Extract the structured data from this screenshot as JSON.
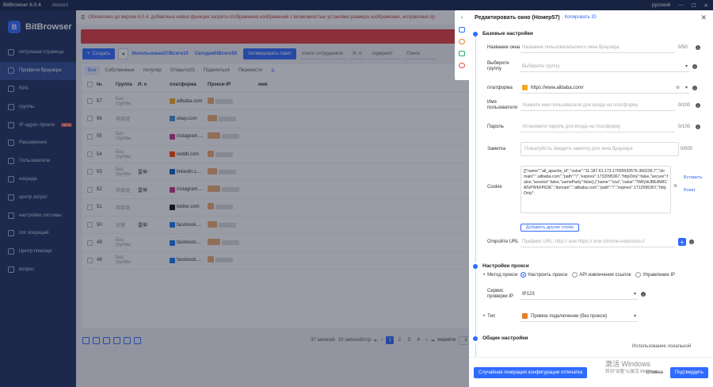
{
  "app": {
    "title": "BitBrowser 6.0.4",
    "user": "zenze1",
    "language": "русский",
    "logo_text": "BitBrowser"
  },
  "sidebar": {
    "items": [
      {
        "label": "питульная страница",
        "active": false
      },
      {
        "label": "Профили браузера",
        "active": true
      },
      {
        "label": "RPA",
        "active": false
      },
      {
        "label": "группы",
        "active": false
      },
      {
        "label": "IP-адрес прокси",
        "active": false,
        "badge": "NEW"
      },
      {
        "label": "Расширения",
        "active": false
      },
      {
        "label": "Пользователи",
        "active": false
      },
      {
        "label": "награда",
        "active": false
      },
      {
        "label": "центр затрат",
        "active": false
      },
      {
        "label": "настройки системы",
        "active": false
      },
      {
        "label": "лог операций",
        "active": false
      },
      {
        "label": "Центр помощи",
        "active": false
      },
      {
        "label": "вопрос",
        "active": false
      }
    ]
  },
  "notice": "Обновлено до версии 6.0.4, добавлена новая функция запрета отображения изображений с возможностью установки размера изображения, исправлена пр",
  "toolbar": {
    "create": "Создать",
    "used": "Использован37/Всего10",
    "today": "Сегодня0/Всего50",
    "activate": "Активировать пакет",
    "search_staff": "поиск сотрудников",
    "and_or": "И, о:",
    "contains": "содержит",
    "search": "Поиск"
  },
  "tabs": [
    "Все",
    "Собственные",
    "популяр",
    "Открыто(0)",
    "Поделиться",
    "Перенести"
  ],
  "table": {
    "headers": [
      "№",
      "Группа",
      "И. о",
      "платформа",
      "Прокси-IP",
      "имя"
    ],
    "rows": [
      {
        "no": "57",
        "group": "Без группы",
        "note": "",
        "platform": "alibaba.com",
        "icon_color": "#f5a623"
      },
      {
        "no": "56",
        "group": "项目组",
        "note": "",
        "platform": "ebay.com",
        "icon_color": "#4a90d9"
      },
      {
        "no": "55",
        "group": "Без группы",
        "note": "",
        "platform": "instagram....",
        "icon_color": "#c13584"
      },
      {
        "no": "54",
        "group": "Без группы",
        "note": "",
        "platform": "reddit.com",
        "icon_color": "#ff4500"
      },
      {
        "no": "53",
        "group": "Без группы",
        "note": "雷伸",
        "platform": "linkedin.c...",
        "icon_color": "#0a66c2"
      },
      {
        "no": "52",
        "group": "项目组",
        "note": "雷伸",
        "platform": "instagram....",
        "icon_color": "#c13584"
      },
      {
        "no": "51",
        "group": "项目组",
        "note": "",
        "platform": "twitter.com",
        "icon_color": "#111111"
      },
      {
        "no": "50",
        "group": "运营",
        "note": "雷伸",
        "platform": "facebook....",
        "icon_color": "#1877f2"
      },
      {
        "no": "49",
        "group": "Без группы",
        "note": "",
        "platform": "facebook....",
        "icon_color": "#1877f2"
      },
      {
        "no": "48",
        "group": "Без группы",
        "note": "",
        "platform": "facebook....",
        "icon_color": "#1877f2"
      }
    ]
  },
  "pager": {
    "total": "37 записей",
    "per_page": "10 записей/стр",
    "pages": [
      "1",
      "2",
      "3",
      "4"
    ],
    "current": "1",
    "goto": "перейти",
    "goto_value": "1"
  },
  "panel": {
    "title": "Редактировать окно  (Номер57)",
    "copy_id": "Копировать ID",
    "basic_title": "Базовые настройки",
    "name_label": "Название окна",
    "name_placeholder": "Название пользовательского окна браузера",
    "name_count": "0/50",
    "group_label": "Выберите группу",
    "group_placeholder": "Выберите группу",
    "platform_label": "платформа",
    "platform_value": "https://www.alibaba.com/",
    "username_label": "Имя пользователя",
    "username_placeholder": "Укажите имя пользователя для входа на платформу",
    "username_count": "0/100",
    "password_label": "Пароль",
    "password_placeholder": "Установите пароль для входа на платформу",
    "password_count": "0/100",
    "note_label": "Заметка",
    "note_placeholder": "Пожалуйста, введите заметку для окна браузера",
    "note_count": "0/500",
    "cookie_label": "Cookie",
    "cookie_value": "[{\"name\":\"ali_apache_id\",\"value\":\"11.187.61.173.17005593576.366239.7\",\"domain\":\".alibaba.com\",\"path\":\"/\",\"expires\":1732095367,\"httpOnly\":false,\"secure\":false,\"session\":false,\"sameParty\":false},{\"name\":\"cna\",\"value\":\"/WFjHUBEAWICATsPWhFP62E\",\"domain\":\".alibaba.com\",\"path\":\"/\",\"expires\":1712095367,\"httpOnly\":",
    "cookie_insert": "Вставить",
    "cookie_format": "Бокат",
    "add_cookie": "Добавить другие cookie",
    "url_label": "Откройте URL",
    "url_placeholder": "Префикс URL: http:// или https:// или chrome-extension://",
    "proxy_title": "Настройки прокси",
    "proxy_method_label": "Метод прокси",
    "proxy_methods": [
      "Настроить прокси",
      "API извлечения ссылок",
      "Управление IP"
    ],
    "check_label": "Сервис проверки IP",
    "check_value": "IP123",
    "type_label": "Тип",
    "type_value": "Прямое подключение (без прокси)",
    "general_title": "Общие настройки",
    "local_cache_hint": "Использование локальной",
    "random_btn": "Случайная генерация конфигурации отпечатка",
    "cancel_btn": "Отмена",
    "confirm_btn": "Подтвердить"
  },
  "watermark": {
    "line1": "激活 Windows",
    "line2": "转到\"设置\"以激活 Windows。"
  }
}
